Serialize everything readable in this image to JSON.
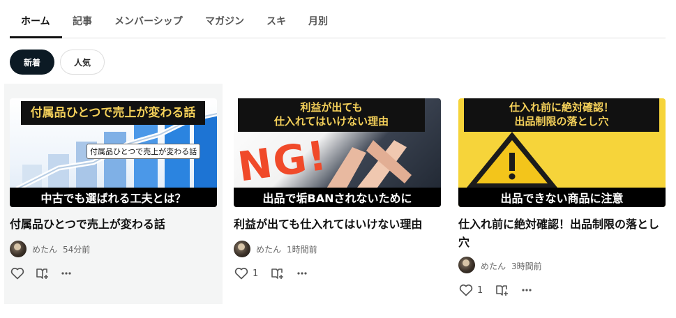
{
  "tabs": [
    "ホーム",
    "記事",
    "メンバーシップ",
    "マガジン",
    "スキ",
    "月別"
  ],
  "filters": {
    "new": "新着",
    "popular": "人気"
  },
  "cards": [
    {
      "thumb_top": "付属品ひとつで売上が変わる話",
      "thumb_label": "付属品ひとつで売上が変わる話",
      "thumb_bottom": "中古でも選ばれる工夫とは？",
      "title": "付属品ひとつで売上が変わる話",
      "author": "めたん",
      "time": "54分前",
      "likes": ""
    },
    {
      "thumb_top_line1": "利益が出ても",
      "thumb_top_line2": "仕入れてはいけない理由",
      "thumb_ng": "NG!",
      "thumb_bottom": "出品で垢BANされないために",
      "title": "利益が出ても仕入れてはいけない理由",
      "author": "めたん",
      "time": "1時間前",
      "likes": "1"
    },
    {
      "thumb_top_line1": "仕入れ前に絶対確認！",
      "thumb_top_line2": "出品制限の落とし穴",
      "thumb_bottom": "出品できない商品に注意",
      "title": "仕入れ前に絶対確認！出品制限の落とし穴",
      "author": "めたん",
      "time": "3時間前",
      "likes": "1"
    }
  ],
  "icons": {
    "like": "heart-icon",
    "save": "bookmark-add-icon",
    "more": "more-dots-icon"
  },
  "colors": {
    "caption_yellow": "#f5d15a",
    "ng_red": "#f04a2a",
    "warning_yellow": "#f6d43a",
    "dark": "#0c1a24"
  }
}
